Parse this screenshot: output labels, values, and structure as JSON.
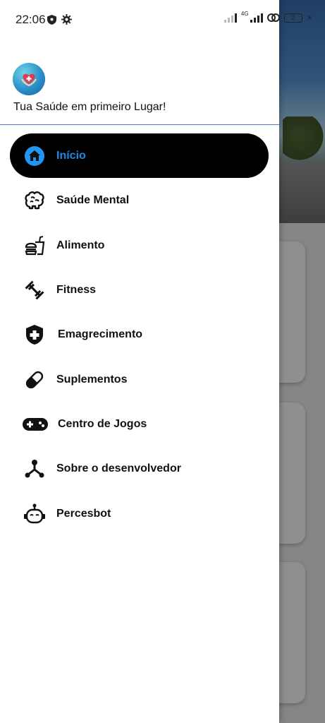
{
  "status_bar": {
    "time": "22:06",
    "network": "4G",
    "battery": "2",
    "icons": [
      "shield-icon",
      "gear-icon",
      "signal-icon",
      "signal-4g-icon",
      "link-icon",
      "battery-icon",
      "charging-icon"
    ]
  },
  "header": {
    "title": "Tua Saúde em primeiro Lugar!",
    "logo": "heart-hands-logo"
  },
  "menu": {
    "items": [
      {
        "label": "Início",
        "icon": "home-icon",
        "active": true
      },
      {
        "label": "Saúde Mental",
        "icon": "brain-icon",
        "active": false
      },
      {
        "label": "Alimento",
        "icon": "fastfood-icon",
        "active": false
      },
      {
        "label": "Fitness",
        "icon": "dumbbell-icon",
        "active": false
      },
      {
        "label": "Emagrecimento",
        "icon": "health-shield-icon",
        "active": false
      },
      {
        "label": "Suplementos",
        "icon": "pill-icon",
        "active": false
      },
      {
        "label": "Centro de Jogos",
        "icon": "gamepad-icon",
        "active": false
      },
      {
        "label": "Sobre o desenvolvedor",
        "icon": "hub-icon",
        "active": false
      },
      {
        "label": "Percesbot",
        "icon": "robot-icon",
        "active": false
      }
    ]
  },
  "colors": {
    "active_bg": "#000000",
    "active_text": "#1e88e5",
    "divider": "#5b73c9"
  }
}
